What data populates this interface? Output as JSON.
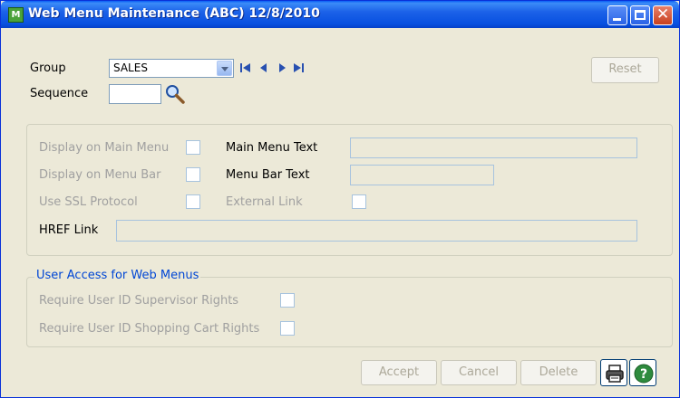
{
  "window": {
    "title": "Web Menu Maintenance (ABC) 12/8/2010",
    "app_icon_letter": "M"
  },
  "header": {
    "group_label": "Group",
    "group_value": "SALES",
    "sequence_label": "Sequence",
    "sequence_value": "",
    "reset_label": "Reset"
  },
  "menu": {
    "display_main_label": "Display on Main Menu",
    "display_menubar_label": "Display on Menu Bar",
    "ssl_label": "Use SSL Protocol",
    "main_menu_text_label": "Main Menu Text",
    "main_menu_text_value": "",
    "menu_bar_text_label": "Menu Bar Text",
    "menu_bar_text_value": "",
    "external_link_label": "External Link",
    "href_label": "HREF Link",
    "href_value": ""
  },
  "access": {
    "title": "User Access for Web Menus",
    "supervisor_label": "Require User ID Supervisor Rights",
    "cart_label": "Require User ID Shopping Cart Rights"
  },
  "footer": {
    "accept_label": "Accept",
    "cancel_label": "Cancel",
    "delete_label": "Delete"
  },
  "colors": {
    "titlebar": "#0a5ef5",
    "window_bg": "#ece9d8",
    "group_title": "#0046d5",
    "disabled_text": "#a0a0a0",
    "nav_arrow": "#2850b0",
    "help_icon": "#2e8b3e"
  }
}
